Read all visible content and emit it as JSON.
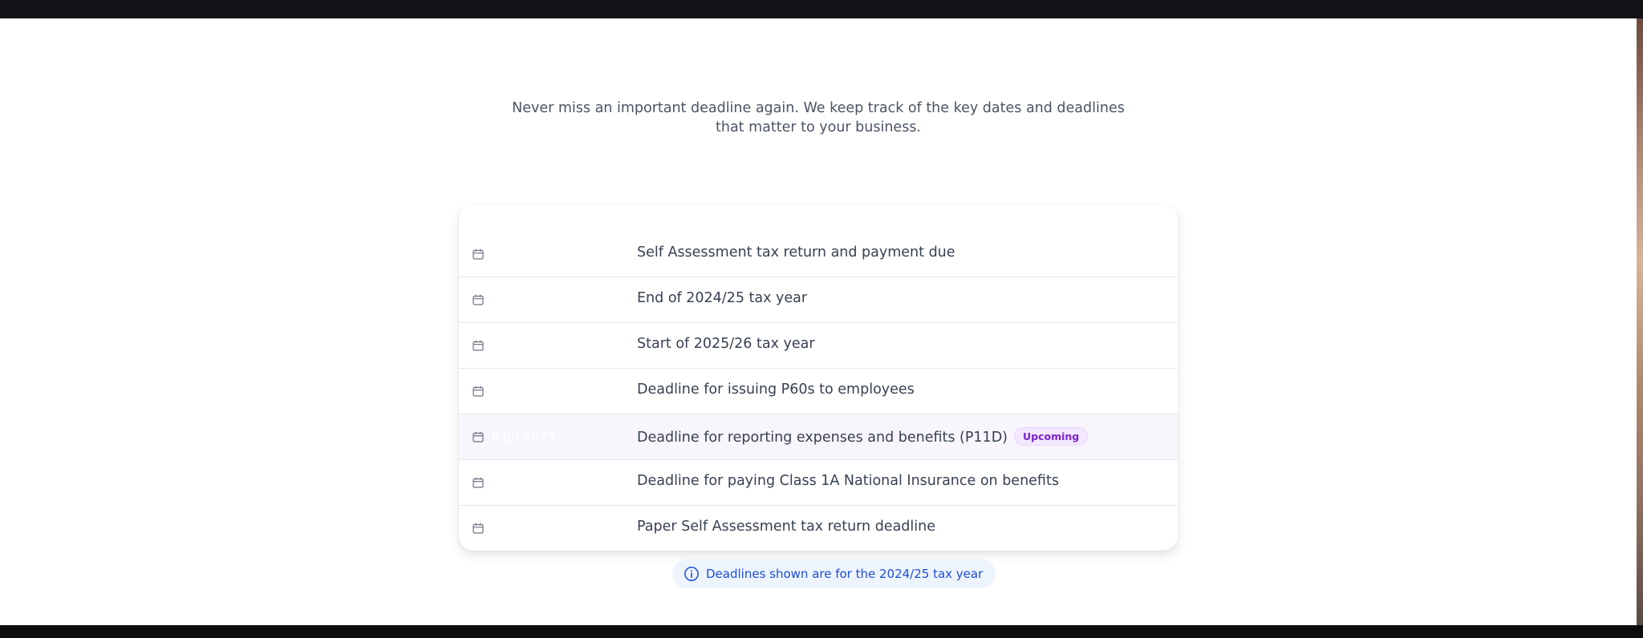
{
  "intro": "Never miss an important deadline again. We keep track of the key dates and deadlines that matter to your business.",
  "deadlines": [
    {
      "date": "",
      "title": "Self Assessment tax return and payment due",
      "badge": ""
    },
    {
      "date": "",
      "title": "End of 2024/25 tax year",
      "badge": ""
    },
    {
      "date": "",
      "title": "Start of 2025/26 tax year",
      "badge": ""
    },
    {
      "date": "",
      "title": "Deadline for issuing P60s to employees",
      "badge": ""
    },
    {
      "date": "6 Jul 2025",
      "title": "Deadline for reporting expenses and benefits (P11D)",
      "badge": "Upcoming"
    },
    {
      "date": "",
      "title": "Deadline for paying Class 1A National Insurance on benefits",
      "badge": ""
    },
    {
      "date": "",
      "title": "Paper Self Assessment tax return deadline",
      "badge": ""
    }
  ],
  "note": "Deadlines shown are for the 2024/25 tax year",
  "icons": {
    "row": "calendar-icon",
    "note": "info-icon"
  },
  "colors": {
    "badge": "#7e22ce",
    "highlight_row": "#f8f5fd",
    "note_text": "#1d4ed8"
  }
}
